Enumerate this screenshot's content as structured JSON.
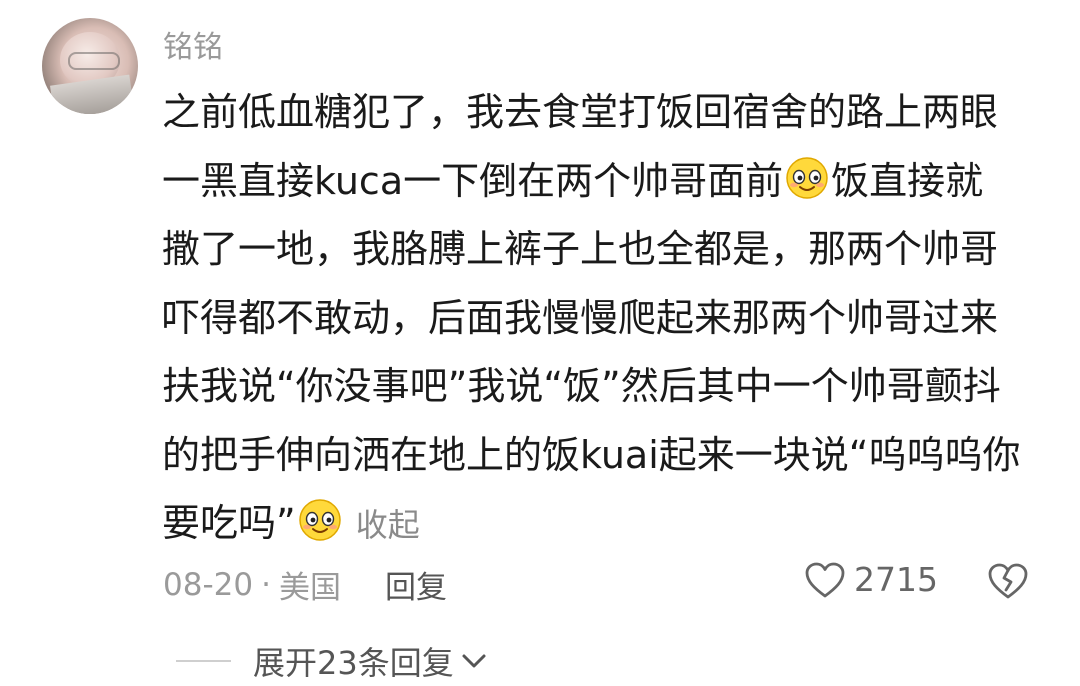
{
  "comment": {
    "username": "铭铭",
    "lines": [
      "之前低血糖犯了，我去食堂打饭回宿舍的路上两眼",
      "一黑直接kuca一下倒在两个帅哥面前",
      "饭直接就",
      "撒了一地，我胳膊上裤子上也全都是，那两个帅哥",
      "吓得都不敢动，后面我慢慢爬起来那两个帅哥过来",
      "扶我说“你没事吧”我说“饭”然后其中一个帅哥颤抖",
      "的把手伸向洒在地上的饭kuai起来一块说“呜呜呜你",
      "要吃吗”"
    ],
    "emoji": "smiling-face-emoji",
    "collapse_label": "收起",
    "date": "08-20",
    "separator": "·",
    "location": "美国",
    "reply_label": "回复",
    "like_count": "2715",
    "expand_label": "展开23条回复"
  },
  "colors": {
    "text": "#1a1a1a",
    "muted": "#9a9a9a",
    "emoji_face": "#ffd93b"
  }
}
